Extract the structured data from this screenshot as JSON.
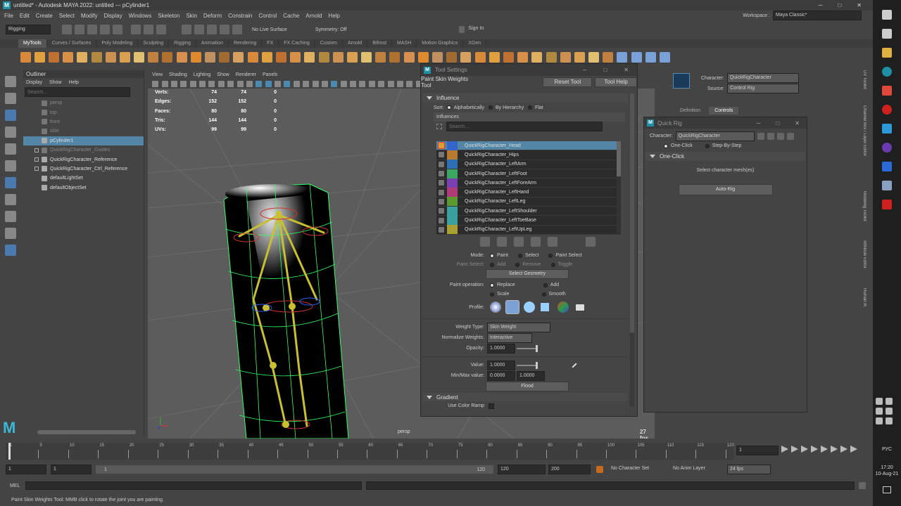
{
  "titlebar": {
    "title": "untitled* - Autodesk MAYA 2022: untitled   ---   pCylinder1",
    "min": "─",
    "max": "□",
    "close": "✕"
  },
  "menubar": {
    "items": [
      "File",
      "Edit",
      "Create",
      "Select",
      "Modify",
      "Display",
      "Windows",
      "Skeleton",
      "Skin",
      "Deform",
      "Constrain",
      "Control",
      "Cache",
      "Arnold",
      "Help"
    ],
    "workspace_label": "Workspace :",
    "workspace_value": "Maya Classic*"
  },
  "statusline": {
    "menuset": "Rigging",
    "live_surface": "No Live Surface",
    "symmetry": "Symmetry: Off",
    "signin": "Sign In"
  },
  "shelf": {
    "tabs": [
      "MyTools",
      "Curves / Surfaces",
      "Poly Modeling",
      "Sculpting",
      "Rigging",
      "Animation",
      "Rendering",
      "FX",
      "FX Caching",
      "Custom",
      "Arnold",
      "Bifrost",
      "MASH",
      "Motion Graphics",
      "XGen"
    ]
  },
  "outliner": {
    "title": "Outliner",
    "menus": [
      "Display",
      "Show",
      "Help"
    ],
    "search_placeholder": "Search...",
    "items": [
      {
        "label": "persp",
        "dim": true
      },
      {
        "label": "top",
        "dim": true
      },
      {
        "label": "front",
        "dim": true
      },
      {
        "label": "side",
        "dim": true
      },
      {
        "label": "pCylinder1",
        "selected": true
      },
      {
        "label": "QuickRigCharacter_Guides",
        "dim": true
      },
      {
        "label": "QuickRigCharacter_Reference"
      },
      {
        "label": "QuickRigCharacter_Ctrl_Reference"
      },
      {
        "label": "defaultLightSet"
      },
      {
        "label": "defaultObjectSet"
      }
    ]
  },
  "viewport": {
    "menus": [
      "View",
      "Shading",
      "Lighting",
      "Show",
      "Renderer",
      "Panels"
    ],
    "hud": [
      [
        "Verts:",
        "74",
        "74",
        "0"
      ],
      [
        "Edges:",
        "152",
        "152",
        "0"
      ],
      [
        "Faces:",
        "80",
        "80",
        "0"
      ],
      [
        "Tris:",
        "144",
        "144",
        "0"
      ],
      [
        "UVs:",
        "99",
        "99",
        "0"
      ]
    ],
    "camera": "persp",
    "fps": "27 fps"
  },
  "tool_settings": {
    "title": "Tool Settings",
    "tool_name": "Paint Skin Weights Tool",
    "reset": "Reset Tool",
    "help": "Tool Help",
    "influence_header": "Influence",
    "sort_label": "Sort:",
    "sort_options": [
      "Alphabetically",
      "By Hierarchy",
      "Flat"
    ],
    "influences_label": "Influences",
    "search_placeholder": "Search...",
    "influences": [
      {
        "name": "QuickRigCharacter_Head",
        "color": "#3465c8"
      },
      {
        "name": "QuickRigCharacter_Hips",
        "color": "#b87a30"
      },
      {
        "name": "QuickRigCharacter_LeftArm",
        "color": "#2c6fb5"
      },
      {
        "name": "QuickRigCharacter_LeftFoot",
        "color": "#3aa860"
      },
      {
        "name": "QuickRigCharacter_LeftForeArm",
        "color": "#7a3fb0"
      },
      {
        "name": "QuickRigCharacter_LeftHand",
        "color": "#b03a7a"
      },
      {
        "name": "QuickRigCharacter_LeftLeg",
        "color": "#5a9a2e"
      },
      {
        "name": "QuickRigCharacter_LeftShoulder",
        "color": "#3aa0a0"
      },
      {
        "name": "QuickRigCharacter_LeftToeBase",
        "color": "#3aa0a0"
      },
      {
        "name": "QuickRigCharacter_LeftUpLeg",
        "color": "#a8a030"
      }
    ],
    "mode_label": "Mode:",
    "mode_options": [
      "Paint",
      "Select",
      "Paint Select"
    ],
    "paint_select_label": "Paint Select:",
    "paint_select_options": [
      "Add",
      "Remove",
      "Toggle"
    ],
    "select_geometry": "Select Geometry",
    "paint_op_label": "Paint operation:",
    "paint_ops": [
      "Replace",
      "Add",
      "Scale",
      "Smooth"
    ],
    "profile_label": "Profile:",
    "weight_type_label": "Weight Type:",
    "weight_type": "Skin Weight",
    "normalize_label": "Normalize Weights:",
    "normalize": "Interactive",
    "opacity_label": "Opacity:",
    "opacity": "1.0000",
    "value_label": "Value:",
    "value": "1.0000",
    "minmax_label": "Min/Max value:",
    "min": "0.0000",
    "max": "1.0000",
    "flood": "Flood",
    "gradient_header": "Gradient",
    "use_color_ramp": "Use Color Ramp"
  },
  "quickrig": {
    "title": "Quick Rig",
    "character_label": "Character:",
    "character": "QuickRigCharacter",
    "modes": [
      "One-Click",
      "Step-By-Step"
    ],
    "section": "One-Click",
    "message": "Select character mesh(es)",
    "autorig": "Auto-Rig"
  },
  "hik": {
    "character_label": "Character:",
    "character": "QuickRigCharacter",
    "source_label": "Source:",
    "source": "Control Rig",
    "tabs": [
      "Definition",
      "Controls"
    ]
  },
  "side_tabs": [
    "UV Toolkit",
    "Channel Box / Layer Editor",
    "Modeling Toolkit",
    "Attribute Editor",
    "Human IK"
  ],
  "timeline": {
    "ticks": [
      "1",
      "5",
      "10",
      "15",
      "20",
      "25",
      "30",
      "35",
      "40",
      "45",
      "50",
      "55",
      "60",
      "65",
      "70",
      "75",
      "80",
      "85",
      "90",
      "95",
      "100",
      "105",
      "110",
      "115",
      "120"
    ],
    "current": "1"
  },
  "range": {
    "start": "1",
    "start2": "1",
    "range_start": "1",
    "range_end": "120",
    "end": "120",
    "end2": "200",
    "no_char": "No Character Set",
    "no_anim": "No Anim Layer",
    "fps": "24 fps"
  },
  "cmdline": {
    "label": "MEL"
  },
  "help_line": "Paint Skin Weights Tool: MMB click to rotate the joint you are painting.",
  "taskbar": {
    "lang": "РУС",
    "time": "17:20",
    "date": "10-Aug-21"
  }
}
